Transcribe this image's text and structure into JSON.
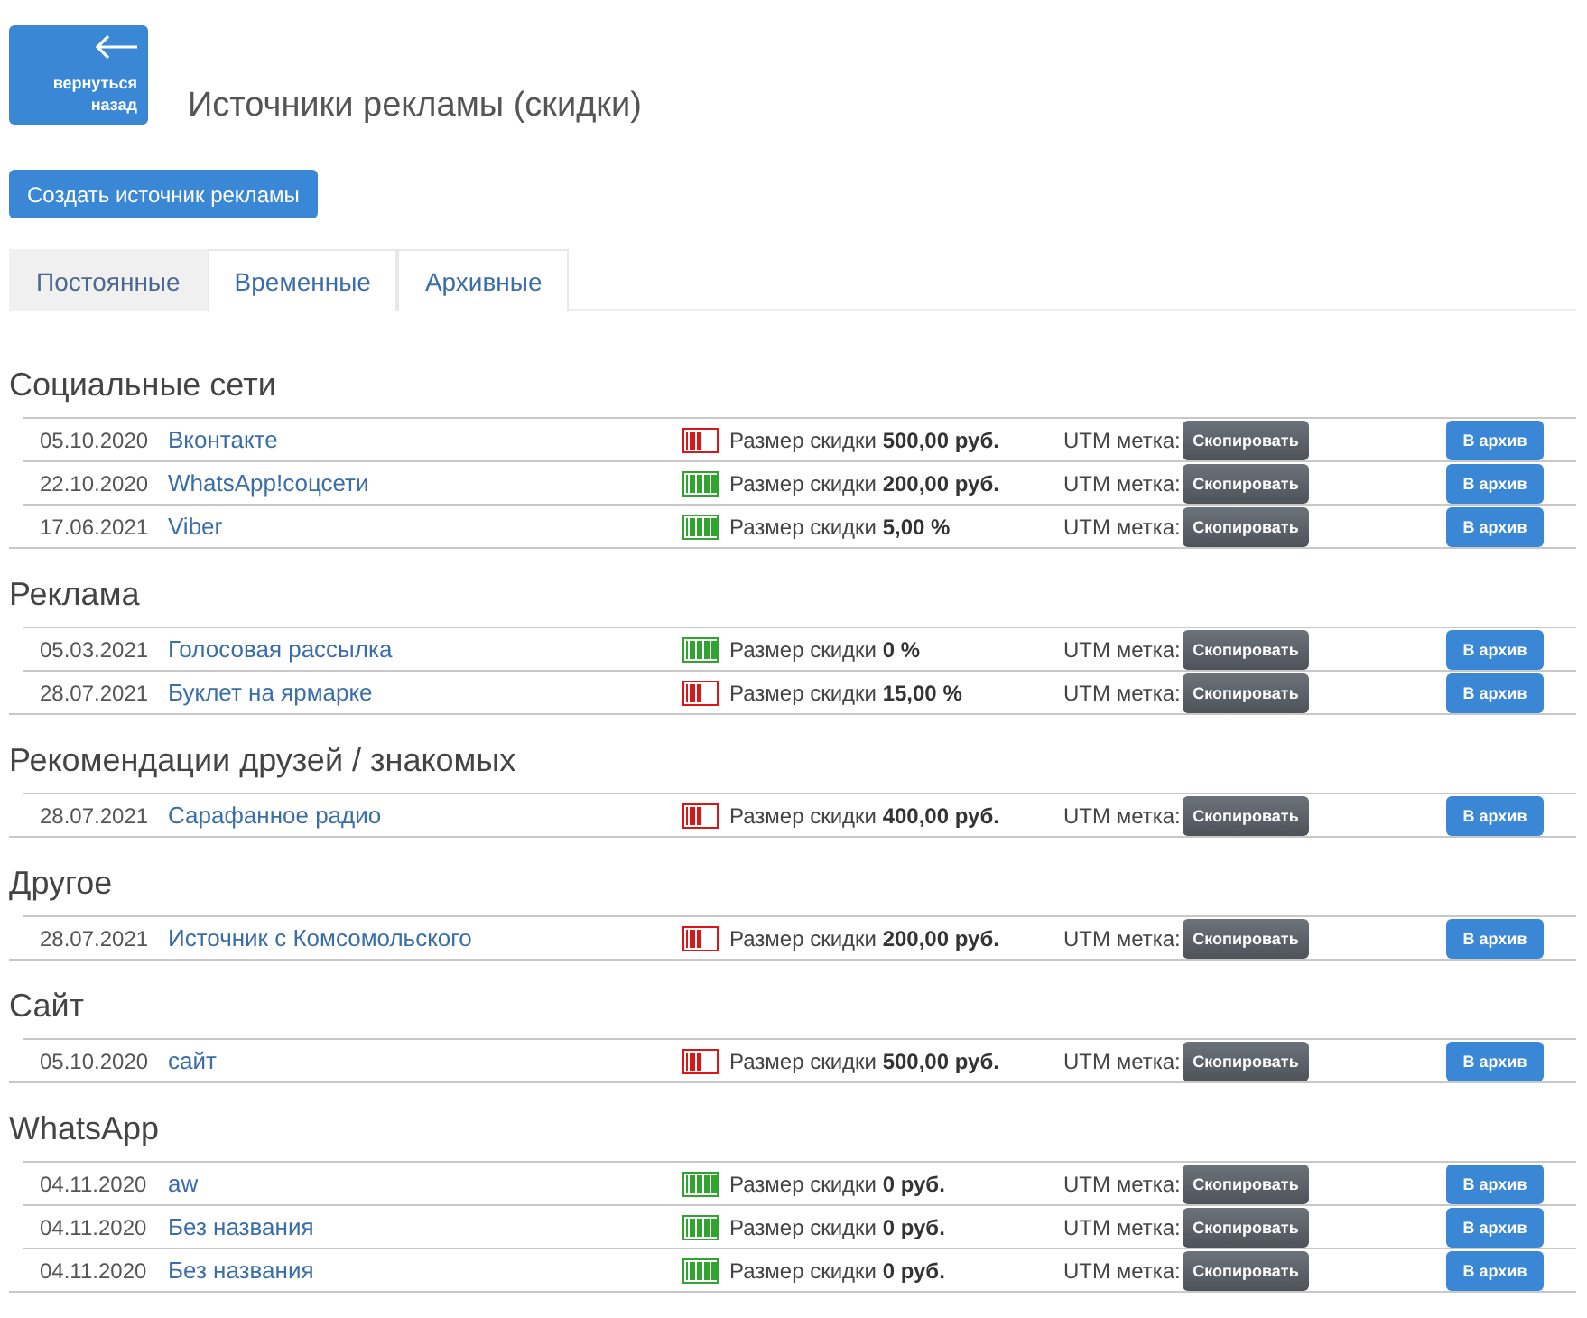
{
  "back_button": {
    "label": "вернуться назад"
  },
  "page_title": "Источники рекламы (скидки)",
  "create_button": {
    "label": "Создать источник рекламы"
  },
  "tabs": [
    {
      "label": "Постоянные",
      "selected": true
    },
    {
      "label": "Временные",
      "selected": false
    },
    {
      "label": "Архивные",
      "selected": false
    }
  ],
  "groups": [
    {
      "title": "Социальные сети",
      "rows": [
        {
          "date": "05.10.2020",
          "name": "Вконтакте",
          "level": 0.5,
          "discount": "Размер скидки **500,00 руб.**",
          "utm_label": "UTM метка:",
          "copy_button": "Скопировать",
          "archive_button": "В архив"
        },
        {
          "date": "22.10.2020",
          "name": "WhatsApp!соцсети",
          "level": 1,
          "discount": "Размер скидки **200,00 руб.**",
          "utm_label": "UTM метка:",
          "copy_button": "Скопировать",
          "archive_button": "В архив"
        },
        {
          "date": "17.06.2021",
          "name": "Viber",
          "level": 1,
          "discount": "Размер скидки **5,00 %**",
          "utm_label": "UTM метка:",
          "copy_button": "Скопировать",
          "archive_button": "В архив"
        }
      ]
    },
    {
      "title": "Реклама",
      "rows": [
        {
          "date": "05.03.2021",
          "name": "Голосовая рассылка",
          "level": 1,
          "discount": "Размер скидки **0 %**",
          "utm_label": "UTM метка:",
          "copy_button": "Скопировать",
          "archive_button": "В архив"
        },
        {
          "date": "28.07.2021",
          "name": "Буклет на ярмарке",
          "level": 0.5,
          "discount": "Размер скидки **15,00 %**",
          "utm_label": "UTM метка:",
          "copy_button": "Скопировать",
          "archive_button": "В архив"
        }
      ]
    },
    {
      "title": "Рекомендации друзей / знакомых",
      "rows": [
        {
          "date": "28.07.2021",
          "name": "Сарафанное радио",
          "level": 0.5,
          "discount": "Размер скидки **400,00 руб.**",
          "utm_label": "UTM метка:",
          "copy_button": "Скопировать",
          "archive_button": "В архив"
        }
      ]
    },
    {
      "title": "Другое",
      "rows": [
        {
          "date": "28.07.2021",
          "name": "Источник с Комсомольского",
          "level": 0.5,
          "discount": "Размер скидки **200,00 руб.**",
          "utm_label": "UTM метка:",
          "copy_button": "Скопировать",
          "archive_button": "В архив"
        }
      ]
    },
    {
      "title": "Сайт",
      "rows": [
        {
          "date": "05.10.2020",
          "name": "сайт",
          "level": 0.5,
          "discount": "Размер скидки **500,00 руб.**",
          "utm_label": "UTM метка:",
          "copy_button": "Скопировать",
          "archive_button": "В архив"
        }
      ]
    },
    {
      "title": "WhatsApp",
      "rows": [
        {
          "date": "04.11.2020",
          "name": "aw",
          "level": 1,
          "discount": "Размер скидки **0 руб.**",
          "utm_label": "UTM метка:",
          "copy_button": "Скопировать",
          "archive_button": "В архив"
        },
        {
          "date": "04.11.2020",
          "name": "Без названия",
          "level": 1,
          "discount": "Размер скидки **0 руб.**",
          "utm_label": "UTM метка:",
          "copy_button": "Скопировать",
          "archive_button": "В архив"
        },
        {
          "date": "04.11.2020",
          "name": "Без названия",
          "level": 1,
          "discount": "Размер скидки **0 руб.**",
          "utm_label": "UTM метка:",
          "copy_button": "Скопировать",
          "archive_button": "В архив"
        }
      ]
    }
  ]
}
